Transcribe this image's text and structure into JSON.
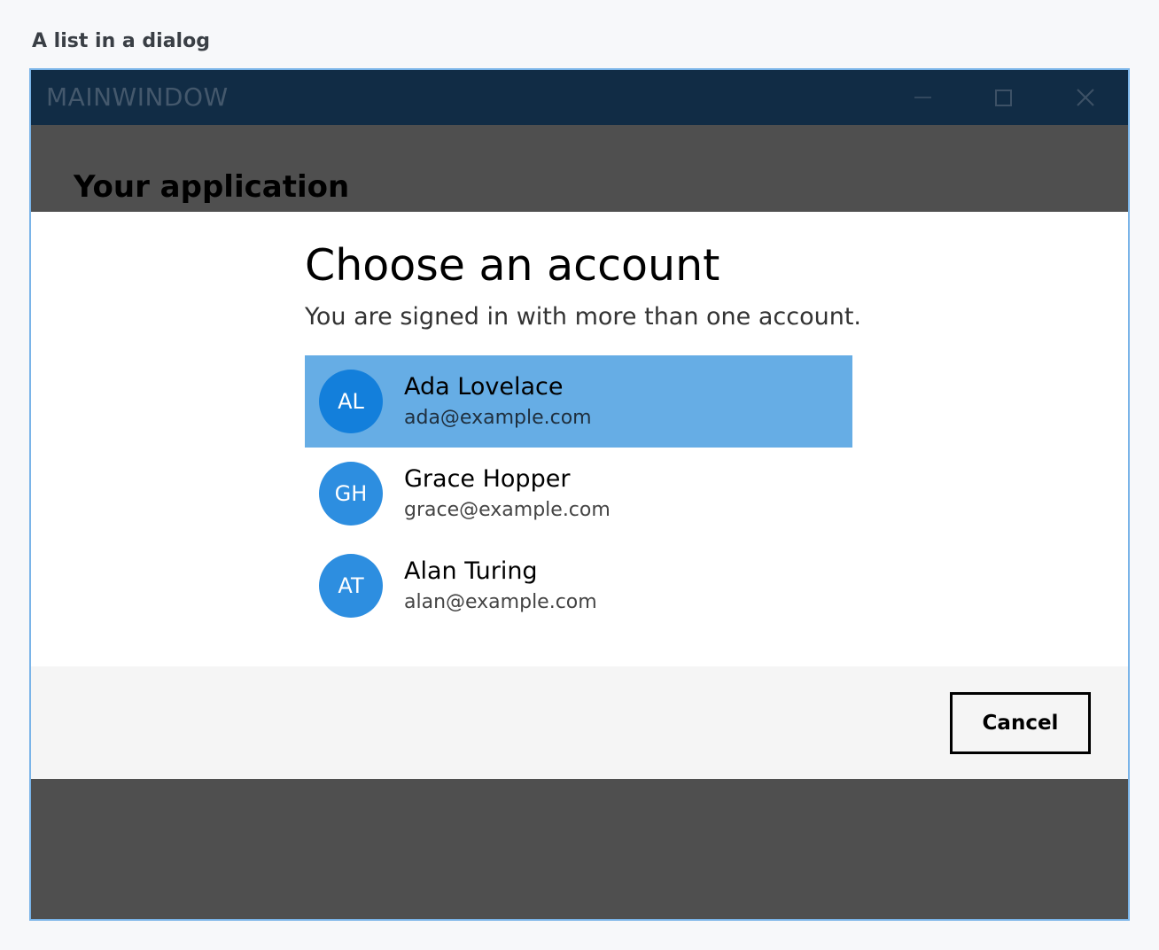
{
  "page": {
    "caption": "A list in a dialog"
  },
  "window": {
    "title": "MAINWINDOW",
    "controls": {
      "minimize_icon": "minimize-icon",
      "maximize_icon": "maximize-icon",
      "close_icon": "close-icon"
    }
  },
  "app": {
    "header": "Your application"
  },
  "dialog": {
    "title": "Choose an account",
    "subtitle": "You are signed in with more than one account.",
    "accounts": [
      {
        "initials": "AL",
        "name": "Ada Lovelace",
        "email": "ada@example.com",
        "selected": true
      },
      {
        "initials": "GH",
        "name": "Grace Hopper",
        "email": "grace@example.com",
        "selected": false
      },
      {
        "initials": "AT",
        "name": "Alan Turing",
        "email": "alan@example.com",
        "selected": false
      }
    ],
    "cancel_label": "Cancel"
  },
  "colors": {
    "titlebar": "#112c45",
    "backdrop": "#4f4f4f",
    "selection": "#66ade5",
    "avatar": "#2d8ee0",
    "avatar_selected": "#137fdb"
  }
}
